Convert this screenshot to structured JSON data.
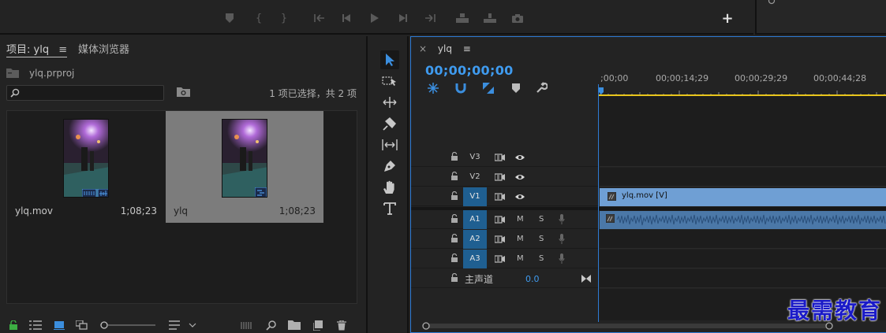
{
  "program_controls": {
    "buttons": [
      "marker-icon",
      "mark-in-icon",
      "mark-out-icon",
      "go-to-in-icon",
      "step-back-icon",
      "play-icon",
      "step-forward-icon",
      "go-to-out-icon",
      "lift-icon",
      "extract-icon",
      "export-frame-icon",
      "add-button-icon"
    ]
  },
  "project": {
    "tab_label": "项目: ylq",
    "tab_menu": "≡",
    "media_browser_label": "媒体浏览器",
    "project_file": "ylq.prproj",
    "selection_status": "1 项已选择，共 2 项",
    "search_placeholder": "",
    "clips": [
      {
        "name": "ylq.mov",
        "duration": "1;08;23",
        "selected": false
      },
      {
        "name": "ylq",
        "duration": "1;08;23",
        "selected": true
      }
    ]
  },
  "timeline": {
    "tab_label": "ylq",
    "tab_menu": "≡",
    "close_label": "×",
    "timecode": "00;00;00;00",
    "ruler": [
      ";00;00",
      "00;00;14;29",
      "00;00;29;29",
      "00;00;44;28"
    ],
    "video_tracks": [
      "V3",
      "V2",
      "V1"
    ],
    "audio_tracks": [
      "A1",
      "A2",
      "A3"
    ],
    "mute_label": "M",
    "solo_label": "S",
    "master_label": "主声道",
    "master_value": "0.0",
    "video_clip_label": "ylq.mov [V]"
  },
  "watermark": "最需教育",
  "colors": {
    "accent": "#2d7bd4",
    "timecode": "#3f9bef",
    "video_clip": "#5b8fc9",
    "audio_clip": "#4b78a8",
    "track_selected": "#1f5f91",
    "work_area": "#e8c51b"
  }
}
